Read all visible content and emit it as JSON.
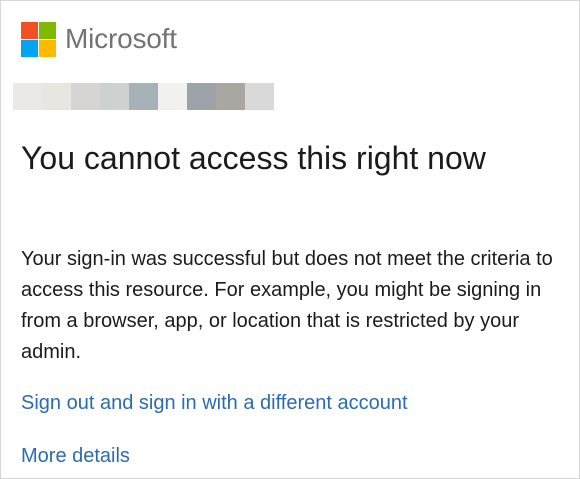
{
  "brand": {
    "name": "Microsoft",
    "logo_colors": [
      "#f25022",
      "#7fba00",
      "#00a4ef",
      "#ffb900"
    ]
  },
  "account": {
    "redacted_blocks": [
      "#ebe8e6",
      "#e9e6e2",
      "#d6d5d3",
      "#cfd0d0",
      "#a7b1b8",
      "#f1f1f0",
      "#9ea3a9",
      "#aaa7a2",
      "#d9d9da"
    ]
  },
  "main": {
    "title": "You cannot access this right now",
    "description": "Your sign-in was successful but does not meet the criteria to access this resource. For example, you might be signing in from a browser, app, or location that is restricted by your admin.",
    "sign_out_link": "Sign out and sign in with a different account",
    "more_details_link": "More details"
  },
  "colors": {
    "link": "#2b6cb0",
    "text": "#1b1b1b",
    "brand_text": "#737373"
  }
}
